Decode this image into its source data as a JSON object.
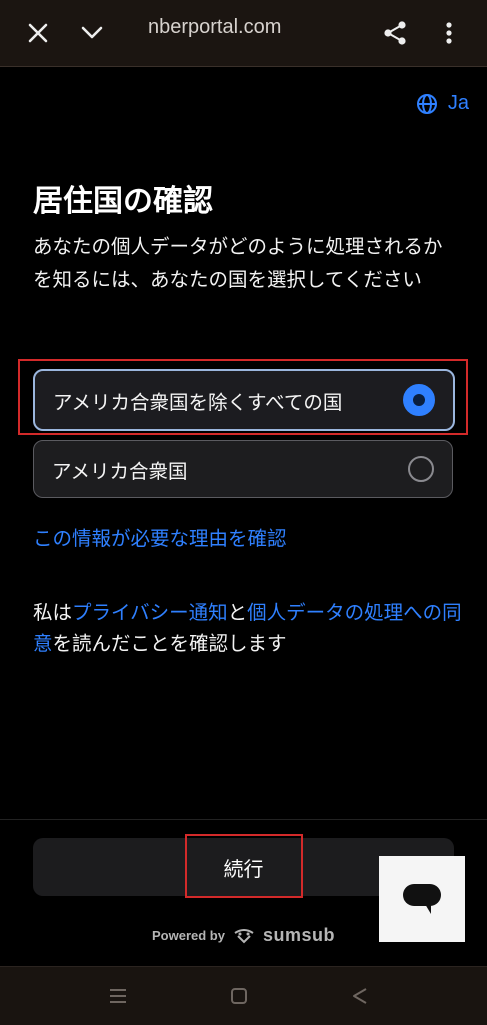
{
  "browser": {
    "url": "nberportal.com",
    "close_icon": "close-icon",
    "collapse_icon": "chevron-down-icon",
    "share_icon": "share-icon",
    "menu_icon": "more-vertical-icon"
  },
  "language": {
    "icon": "globe-icon",
    "label": "Ja"
  },
  "page": {
    "title": "居住国の確認",
    "description": "あなたの個人データがどのように処理されるかを知るには、あなたの国を選択してください"
  },
  "options": [
    {
      "label": "アメリカ合衆国を除くすべての国",
      "selected": true
    },
    {
      "label": "アメリカ合衆国",
      "selected": false
    }
  ],
  "why_link": "この情報が必要な理由を確認",
  "consent": {
    "prefix": "私は",
    "privacy_link": "プライバシー通知",
    "and": "と",
    "processing_link": "個人データの処理への同意",
    "suffix": "を読んだことを確認します"
  },
  "continue_label": "続行",
  "powered": {
    "text": "Powered by",
    "brand": "sumsub"
  },
  "chat_icon": "chat-icon",
  "system_nav": {
    "recents_icon": "recents-icon",
    "home_icon": "home-icon",
    "back_icon": "back-icon"
  },
  "colors": {
    "accent": "#2f80ff",
    "highlight": "#d32a2a",
    "background": "#000000"
  }
}
